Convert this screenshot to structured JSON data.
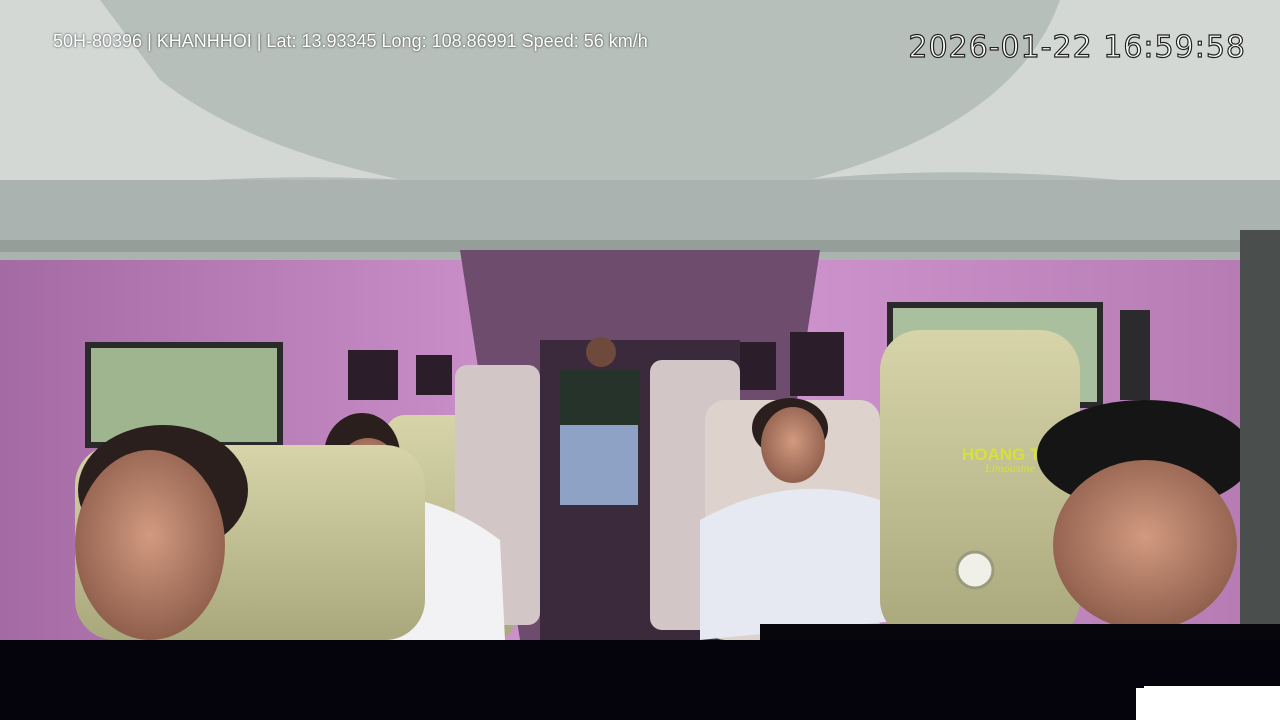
{
  "overlay": {
    "vehicle_info": "50H-80396 | KHANHHOI | Lat: 13.93345 Long: 108.86991 Speed: 56 km/h",
    "timestamp": "2026-01-22 16:59:58"
  },
  "scene": {
    "description_icon": "van-interior-camera-icon",
    "seat_brand": "HOANG TH",
    "seat_brand_sub": "Limousine"
  },
  "colors": {
    "ceiling": "#b9c1bc",
    "cabin_wall": "#c98fc4",
    "seat": "#c9c79a",
    "floor": "#1a1420",
    "letterbox": "#05040c"
  }
}
